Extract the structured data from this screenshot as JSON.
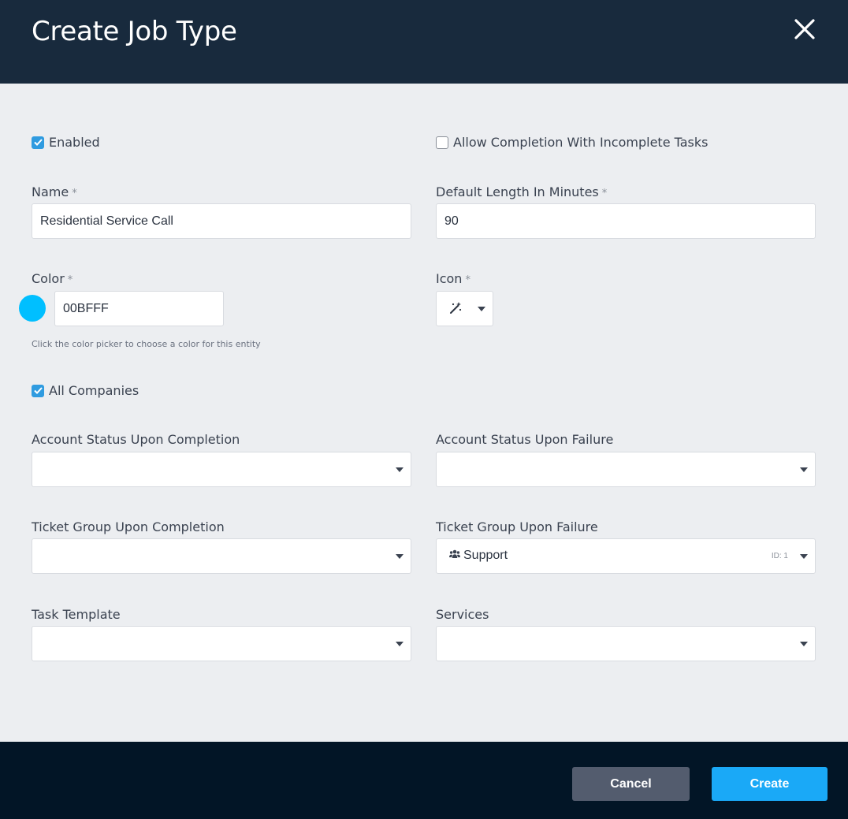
{
  "dialog": {
    "title": "Create Job Type"
  },
  "form": {
    "enabled": {
      "label": "Enabled",
      "checked": true
    },
    "allow_incomplete": {
      "label": "Allow Completion With Incomplete Tasks",
      "checked": false
    },
    "name": {
      "label": "Name",
      "required_mark": "*",
      "value": "Residential Service Call"
    },
    "default_length": {
      "label": "Default Length In Minutes",
      "required_mark": "*",
      "value": "90"
    },
    "color": {
      "label": "Color",
      "required_mark": "*",
      "value": "00BFFF",
      "swatch": "#00BFFF",
      "hint": "Click the color picker to choose a color for this entity"
    },
    "icon": {
      "label": "Icon",
      "required_mark": "*",
      "value_icon": "magic-wand-icon"
    },
    "all_companies": {
      "label": "All Companies",
      "checked": true
    },
    "account_status_completion": {
      "label": "Account Status Upon Completion",
      "value": ""
    },
    "account_status_failure": {
      "label": "Account Status Upon Failure",
      "value": ""
    },
    "ticket_group_completion": {
      "label": "Ticket Group Upon Completion",
      "value": ""
    },
    "ticket_group_failure": {
      "label": "Ticket Group Upon Failure",
      "value": "Support",
      "value_icon": "users-icon",
      "id_text": "ID: 1"
    },
    "task_template": {
      "label": "Task Template",
      "value": ""
    },
    "services": {
      "label": "Services",
      "value": ""
    }
  },
  "footer": {
    "cancel_label": "Cancel",
    "create_label": "Create"
  },
  "colors": {
    "header_bg": "#182A3D",
    "footer_bg": "#021526",
    "accent": "#1AA9F7",
    "cancel_bg": "#535C6E"
  }
}
